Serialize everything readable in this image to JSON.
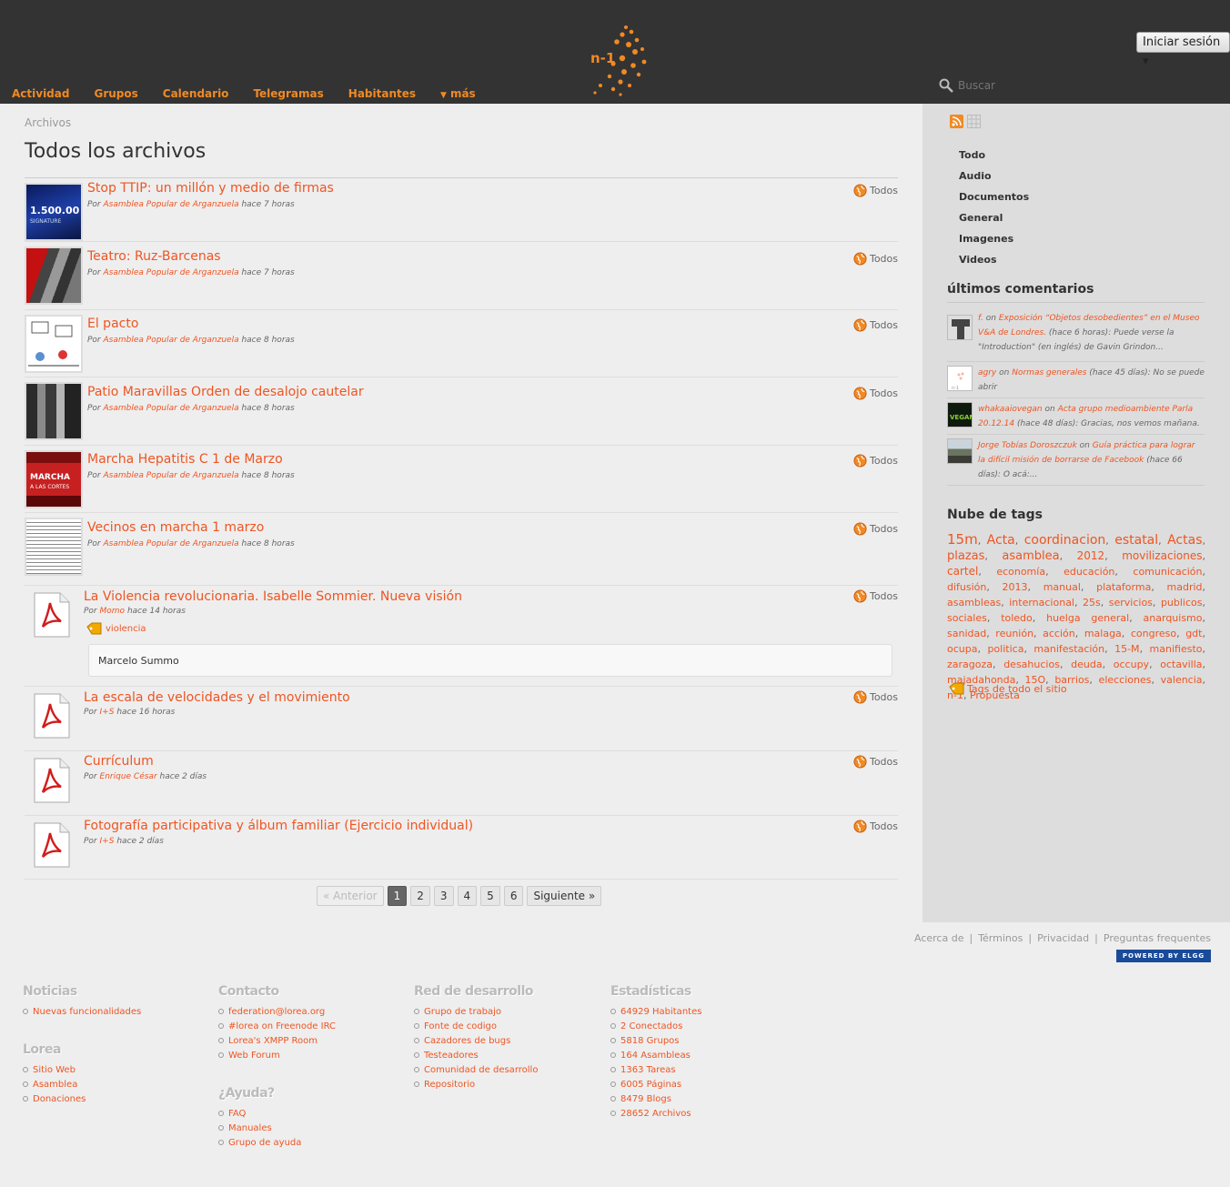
{
  "nav": {
    "items": [
      "Actividad",
      "Grupos",
      "Calendario",
      "Telegramas",
      "Habitantes"
    ],
    "more": "más"
  },
  "header": {
    "login": "Iniciar sesión",
    "search_placeholder": "Buscar"
  },
  "breadcrumb": "Archivos",
  "page_title": "Todos los archivos",
  "access_label": "Todos",
  "items": [
    {
      "title": "Stop TTIP: un millón y medio de firmas",
      "by": "Por",
      "author": "Asamblea Popular de Arganzuela",
      "time": "hace 7 horas"
    },
    {
      "title": "Teatro: Ruz-Barcenas",
      "by": "Por",
      "author": "Asamblea Popular de Arganzuela",
      "time": "hace 7 horas"
    },
    {
      "title": "El pacto",
      "by": "Por",
      "author": "Asamblea Popular de Arganzuela",
      "time": "hace 8 horas"
    },
    {
      "title": "Patio Maravillas Orden de desalojo cautelar",
      "by": "Por",
      "author": "Asamblea Popular de Arganzuela",
      "time": "hace 8 horas"
    },
    {
      "title": "Marcha Hepatitis C 1 de Marzo",
      "by": "Por",
      "author": "Asamblea Popular de Arganzuela",
      "time": "hace 8 horas"
    },
    {
      "title": "Vecinos en marcha 1 marzo",
      "by": "Por",
      "author": "Asamblea Popular de Arganzuela",
      "time": "hace 8 horas"
    },
    {
      "title": "La Violencia revolucionaria. Isabelle Sommier. Nueva visión",
      "by": "Por",
      "author": "Momo",
      "time": "hace 14 horas",
      "tag": "violencia",
      "description": "Marcelo Summo"
    },
    {
      "title": "La escala de velocidades y el movimiento",
      "by": "Por",
      "author": "I+S",
      "time": "hace 16 horas"
    },
    {
      "title": "Currículum",
      "by": "Por",
      "author": "Enrique César",
      "time": "hace 2 días"
    },
    {
      "title": "Fotografía participativa y álbum familiar (Ejercicio individual)",
      "by": "Por",
      "author": "I+S",
      "time": "hace 2 días"
    }
  ],
  "thumbs": [
    "ttip-thumbnail",
    "teatro-thumbnail",
    "pacto-thumbnail",
    "patio-thumbnail",
    "marcha-thumbnail",
    "vecinos-thumbnail"
  ],
  "pagination": {
    "prev": "« Anterior",
    "pages": [
      "1",
      "2",
      "3",
      "4",
      "5",
      "6"
    ],
    "current": "1",
    "next": "Siguiente »"
  },
  "sidebar": {
    "filters": [
      "Todo",
      "Audio",
      "Documentos",
      "General",
      "Imagenes",
      "Videos"
    ],
    "comments_heading": "últimos comentarios",
    "comments": [
      {
        "user": "f.",
        "on": "on",
        "target": "Exposición “Objetos desobedientes” en el Museo V&A de Londres.",
        "rest": "(hace 6 horas): Puede verse la \"Introduction\" (en inglés) de Gavin Grindon..."
      },
      {
        "user": "agry",
        "on": "on",
        "target": "Normas generales",
        "rest": "(hace 45 días): No se puede abrir"
      },
      {
        "user": "whakaaiovegan",
        "on": "on",
        "target": "Acta grupo medioambiente Parla 20.12.14",
        "rest": "(hace 48 días): Gracias, nos vemos mañana."
      },
      {
        "user": "Jorge Tobías Doroszczuk",
        "on": "on",
        "target": "Guía práctica para lograr la difícil misión de borrarse de Facebook",
        "rest": "(hace 66 días): O acá:..."
      }
    ],
    "tags_heading": "Nube de tags",
    "tags": [
      {
        "t": "15m",
        "s": 15
      },
      {
        "t": "Acta",
        "s": 14
      },
      {
        "t": "coordinacion",
        "s": 14
      },
      {
        "t": "estatal",
        "s": 14
      },
      {
        "t": "Actas",
        "s": 14
      },
      {
        "t": "plazas",
        "s": 13
      },
      {
        "t": "asamblea",
        "s": 13
      },
      {
        "t": "2012",
        "s": 12
      },
      {
        "t": "movilizaciones",
        "s": 12
      },
      {
        "t": "cartel",
        "s": 12
      },
      {
        "t": "economía",
        "s": 11
      },
      {
        "t": "educación",
        "s": 11
      },
      {
        "t": "comunicación",
        "s": 11
      },
      {
        "t": "difusión",
        "s": 11
      },
      {
        "t": "2013",
        "s": 11
      },
      {
        "t": "manual",
        "s": 11
      },
      {
        "t": "plataforma",
        "s": 11
      },
      {
        "t": "madrid",
        "s": 11
      },
      {
        "t": "asambleas",
        "s": 11
      },
      {
        "t": "internacional",
        "s": 11
      },
      {
        "t": "25s",
        "s": 11
      },
      {
        "t": "servicios",
        "s": 11
      },
      {
        "t": "publicos",
        "s": 11
      },
      {
        "t": "sociales",
        "s": 11
      },
      {
        "t": "toledo",
        "s": 11
      },
      {
        "t": "huelga general",
        "s": 11
      },
      {
        "t": "anarquismo",
        "s": 11
      },
      {
        "t": "sanidad",
        "s": 11
      },
      {
        "t": "reunión",
        "s": 11
      },
      {
        "t": "acción",
        "s": 11
      },
      {
        "t": "malaga",
        "s": 11
      },
      {
        "t": "congreso",
        "s": 11
      },
      {
        "t": "gdt",
        "s": 11
      },
      {
        "t": "ocupa",
        "s": 11
      },
      {
        "t": "politica",
        "s": 11
      },
      {
        "t": "manifestación",
        "s": 11
      },
      {
        "t": "15-M",
        "s": 11
      },
      {
        "t": "manifiesto",
        "s": 11
      },
      {
        "t": "zaragoza",
        "s": 11
      },
      {
        "t": "desahucios",
        "s": 11
      },
      {
        "t": "deuda",
        "s": 11
      },
      {
        "t": "occupy",
        "s": 11
      },
      {
        "t": "octavilla",
        "s": 11
      },
      {
        "t": "majadahonda",
        "s": 11
      },
      {
        "t": "15O",
        "s": 11
      },
      {
        "t": "barrios",
        "s": 11
      },
      {
        "t": "elecciones",
        "s": 11
      },
      {
        "t": "valencia",
        "s": 11
      },
      {
        "t": "n-1",
        "s": 11
      },
      {
        "t": "Propuesta",
        "s": 11
      }
    ],
    "site_tags": "Tags de todo el sitio"
  },
  "footer": {
    "links": [
      "Acerca de",
      "Términos",
      "Privacidad",
      "Preguntas frequentes"
    ],
    "elgg": "POWERED BY ELGG",
    "columns": [
      {
        "sections": [
          {
            "heading": "Noticias",
            "links": [
              "Nuevas funcionalidades"
            ]
          },
          {
            "heading": "Lorea",
            "links": [
              "Sitio Web",
              "Asamblea",
              "Donaciones"
            ]
          }
        ]
      },
      {
        "sections": [
          {
            "heading": "Contacto",
            "links": [
              "federation@lorea.org",
              "#lorea on Freenode IRC",
              "Lorea's XMPP Room",
              "Web Forum"
            ]
          },
          {
            "heading": "¿Ayuda?",
            "links": [
              "FAQ",
              "Manuales",
              "Grupo de ayuda"
            ]
          }
        ]
      },
      {
        "sections": [
          {
            "heading": "Red de desarrollo",
            "links": [
              "Grupo de trabajo",
              "Fonte de codigo",
              "Cazadores de bugs",
              "Testeadores",
              "Comunidad de desarrollo",
              "Repositorio"
            ]
          }
        ]
      },
      {
        "sections": [
          {
            "heading": "Estadísticas",
            "links": [
              "64929 Habitantes",
              "2 Conectados",
              "5818 Grupos",
              "164 Asambleas",
              "1363 Tareas",
              "6005 Páginas",
              "8479 Blogs",
              "28652 Archivos"
            ]
          }
        ]
      }
    ]
  },
  "colors": {
    "accent": "#ee5522",
    "nav": "#f08a24",
    "header_bg": "#333333",
    "sidebar_bg": "#dddddd"
  }
}
